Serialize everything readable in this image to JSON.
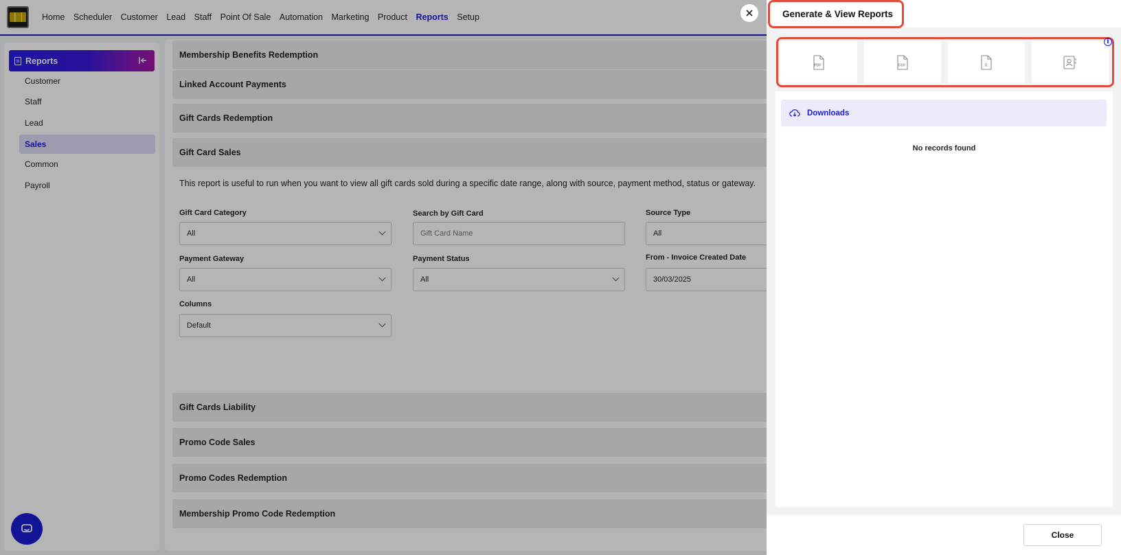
{
  "nav": {
    "items": [
      "Home",
      "Scheduler",
      "Customer",
      "Lead",
      "Staff",
      "Point Of Sale",
      "Automation",
      "Marketing",
      "Product",
      "Reports",
      "Setup"
    ],
    "active": "Reports"
  },
  "sidebar": {
    "title": "Reports",
    "items": [
      {
        "label": "Customer"
      },
      {
        "label": "Staff"
      },
      {
        "label": "Lead"
      },
      {
        "label": "Sales"
      },
      {
        "label": "Common"
      },
      {
        "label": "Payroll"
      }
    ],
    "active": "Sales"
  },
  "main": {
    "sections_top": [
      "Membership Benefits Redemption",
      "Linked Account Payments",
      "Gift Cards Redemption",
      "Gift Card Sales"
    ],
    "expanded": {
      "description": "This report is useful to run when you want to view all gift cards sold during a specific date range, along with source, payment method, status or gateway.",
      "fields": {
        "gift_card_category": {
          "label": "Gift Card Category",
          "value": "All"
        },
        "search_gift_card": {
          "label": "Search by Gift Card",
          "placeholder": "Gift Card Name"
        },
        "source_type": {
          "label": "Source Type",
          "value": "All"
        },
        "payment_gateway": {
          "label": "Payment Gateway",
          "value": "All"
        },
        "payment_status": {
          "label": "Payment Status",
          "value": "All"
        },
        "from_date": {
          "label": "From - Invoice Created Date",
          "value": "30/03/2025"
        },
        "columns": {
          "label": "Columns",
          "value": "Default"
        }
      }
    },
    "sections_bottom": [
      "Gift Cards Liability",
      "Promo Code Sales",
      "Promo Codes Redemption",
      "Membership Promo Code Redemption"
    ]
  },
  "panel": {
    "title": "Generate & View Reports",
    "formats": [
      {
        "icon": "pdf-file-icon",
        "label": "PDF"
      },
      {
        "icon": "csv-file-icon",
        "label": "CSV"
      },
      {
        "icon": "excel-file-icon",
        "label": "X"
      },
      {
        "icon": "contact-book-icon"
      }
    ],
    "downloads_label": "Downloads",
    "empty_text": "No records found",
    "close_label": "Close"
  },
  "colors": {
    "accent": "#1c1cd4",
    "highlight": "#e04b3a",
    "active_bg": "#dcdcf5"
  }
}
